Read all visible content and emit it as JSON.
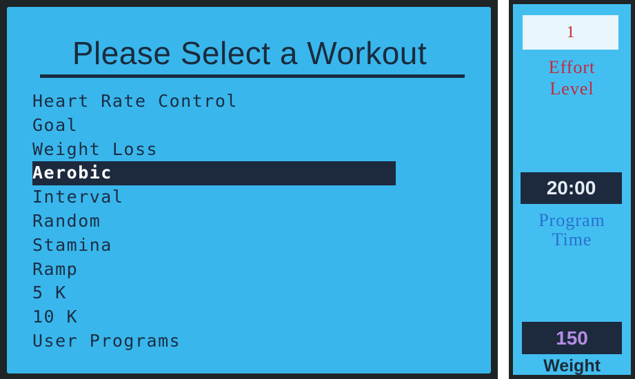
{
  "screen": {
    "title": "Please Select a Workout",
    "selected_index": 3,
    "workouts": [
      "Heart Rate Control",
      "Goal",
      "Weight Loss",
      "Aerobic",
      "Interval",
      "Random",
      "Stamina",
      "Ramp",
      "5 K",
      "10 K",
      "User Programs"
    ]
  },
  "side_panel": {
    "effort_level": {
      "value": "1",
      "label_line1": "Effort",
      "label_line2": "Level"
    },
    "program_time": {
      "value": "20:00",
      "label_line1": "Program",
      "label_line2": "Time"
    },
    "weight": {
      "value": "150",
      "label": "Weight"
    }
  },
  "colors": {
    "screen_background": "#39b7ec",
    "selection_bar": "#1d2a3e",
    "effort_level_text": "#c5283c",
    "program_time_label": "#2b6fd0",
    "weight_value": "#b48de4"
  }
}
